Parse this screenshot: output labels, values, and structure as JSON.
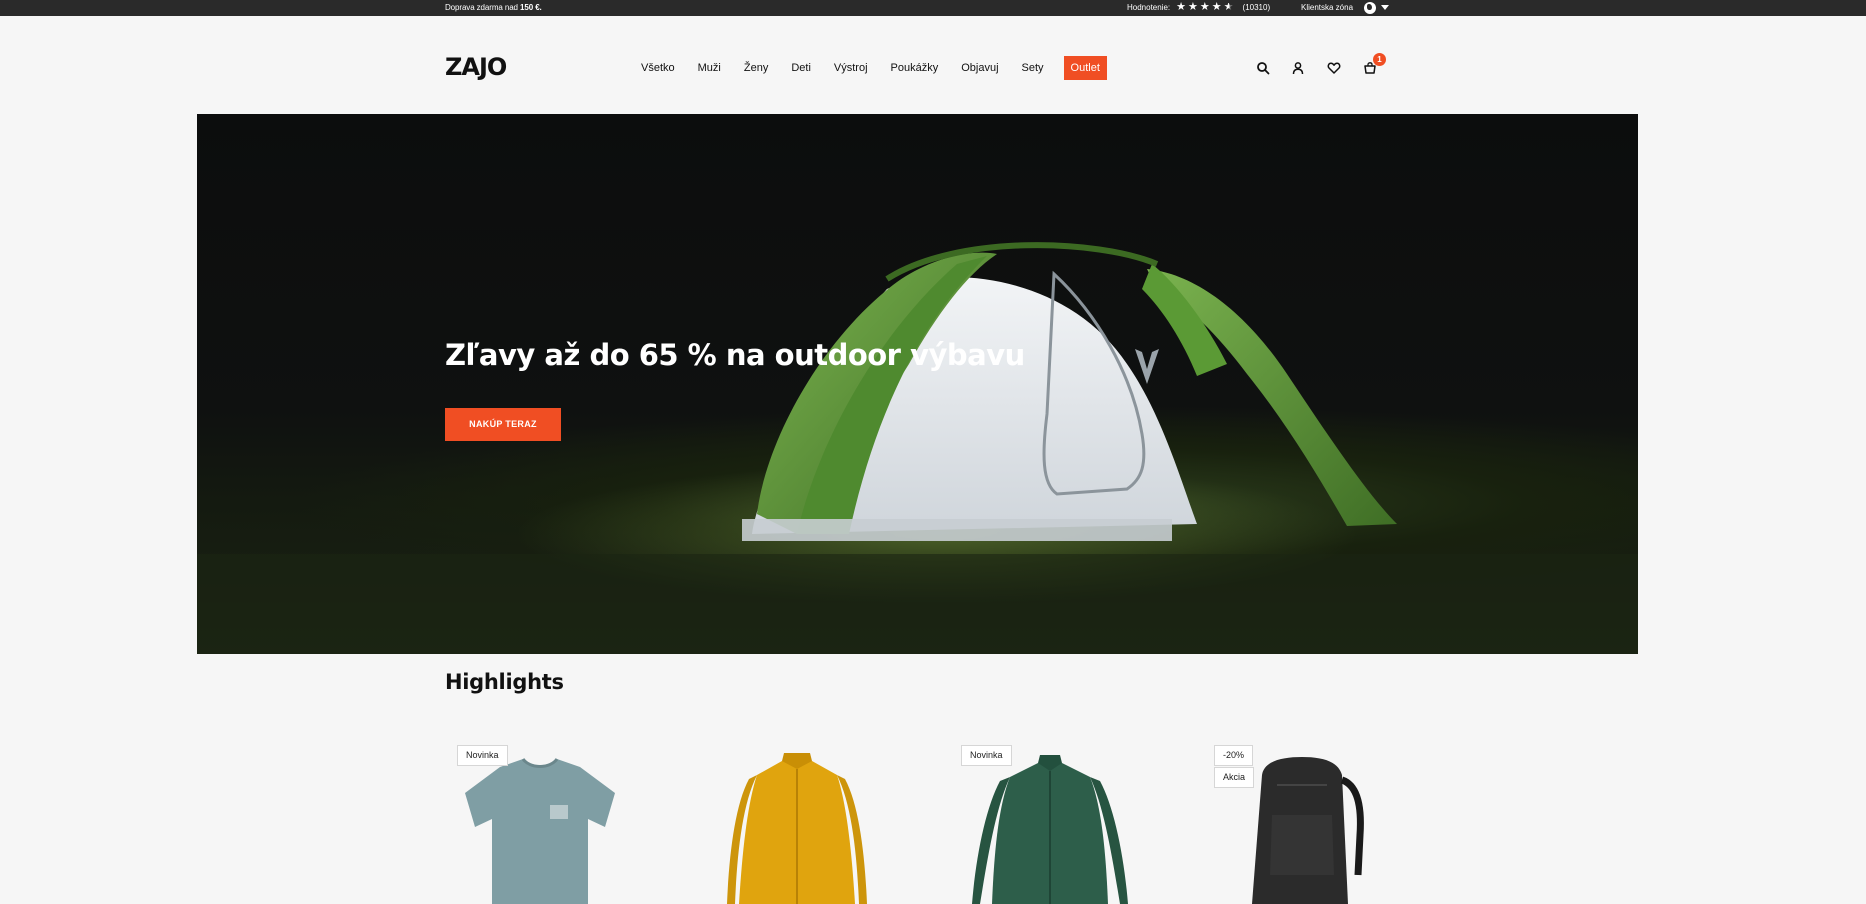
{
  "topbar": {
    "shipping_prefix": "Doprava zdarma nad ",
    "shipping_amount": "150 €.",
    "rating_label": "Hodnotenie:",
    "rating_stars": 4.5,
    "rating_count": "(10310)",
    "client_zone": "Klientska zóna",
    "icons": [
      "star-icon",
      "globe-icon",
      "caret-down-icon"
    ]
  },
  "header": {
    "logo": "ZAJO",
    "nav": [
      {
        "label": "Všetko"
      },
      {
        "label": "Muži"
      },
      {
        "label": "Ženy"
      },
      {
        "label": "Deti"
      },
      {
        "label": "Výstroj"
      },
      {
        "label": "Poukážky"
      },
      {
        "label": "Objavuj"
      },
      {
        "label": "Sety"
      },
      {
        "label": "Outlet"
      }
    ],
    "icons": [
      "search-icon",
      "user-icon",
      "heart-icon",
      "basket-icon"
    ],
    "cart_count": "1"
  },
  "hero": {
    "title": "Zľavy až do 65 % na outdoor výbavu",
    "cta": "NAKÚP TERAZ"
  },
  "highlights": {
    "title": "Highlights",
    "products": [
      {
        "tags": [
          "Novinka"
        ],
        "image": "t-shirt"
      },
      {
        "tags": [],
        "image": "fleece-jacket"
      },
      {
        "tags": [
          "Novinka"
        ],
        "image": "fleece-jacket"
      },
      {
        "tags": [
          "-20%",
          "Akcia"
        ],
        "image": "backpack"
      }
    ]
  },
  "colors": {
    "accent": "#f04e23",
    "topbar": "#2a2a2a",
    "background": "#f6f6f6",
    "tent_green": "#5f9a3c",
    "shirt": "#7f9ea4",
    "jacket_yellow": "#e0a40e",
    "jacket_green": "#2d5e4a",
    "backpack": "#2b2b2b"
  }
}
